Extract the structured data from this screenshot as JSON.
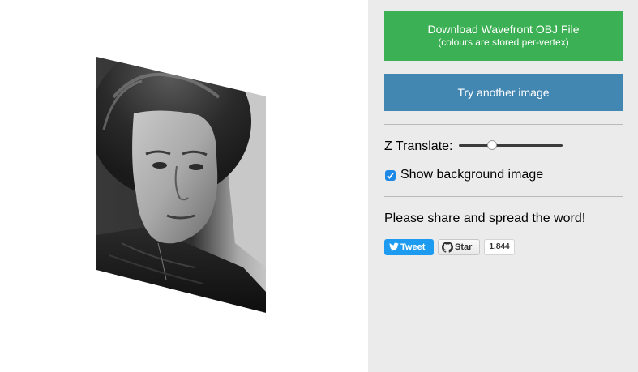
{
  "viewport": {
    "image_alt": "3D reconstructed face of a woman in black and white photo"
  },
  "panel": {
    "download_button": {
      "line1": "Download Wavefront OBJ File",
      "line2": "(colours are stored per-vertex)"
    },
    "try_button_label": "Try another image",
    "z_translate_label": "Z Translate:",
    "z_translate_value": 0.3,
    "show_background": {
      "label": "Show background image",
      "checked": true
    },
    "share_text": "Please share and spread the word!",
    "tweet_label": "Tweet",
    "star_label": "Star",
    "star_count": "1,844"
  },
  "colors": {
    "download": "#3cb054",
    "try": "#4286b2",
    "panel_bg": "#ebebeb",
    "tweet": "#1d9bf0",
    "checkbox": "#1e88e5"
  }
}
